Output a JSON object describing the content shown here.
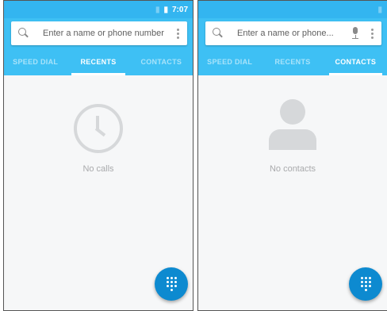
{
  "left_screen": {
    "status": {
      "time": "7:07"
    },
    "search": {
      "placeholder": "Enter a name or phone number"
    },
    "tabs": [
      {
        "label": "SPEED DIAL",
        "active": false
      },
      {
        "label": "RECENTS",
        "active": true
      },
      {
        "label": "CONTACTS",
        "active": false
      }
    ],
    "empty": {
      "icon": "clock-icon",
      "text": "No calls"
    }
  },
  "right_screen": {
    "search": {
      "placeholder": "Enter a name or phone..."
    },
    "tabs": [
      {
        "label": "SPEED DIAL",
        "active": false
      },
      {
        "label": "RECENTS",
        "active": false
      },
      {
        "label": "CONTACTS",
        "active": true
      }
    ],
    "empty": {
      "icon": "person-icon",
      "text": "No contacts"
    }
  },
  "colors": {
    "status_bar": "#33b5f0",
    "app_bar": "#3ec0f4",
    "fab": "#0d8ad0",
    "empty_icon": "#d6d8da",
    "empty_text": "#a9aaac"
  },
  "icons": [
    "search-icon",
    "mic-icon",
    "more-vert-icon",
    "dialpad-icon",
    "clock-icon",
    "person-icon",
    "battery-icon",
    "signal-icon"
  ]
}
